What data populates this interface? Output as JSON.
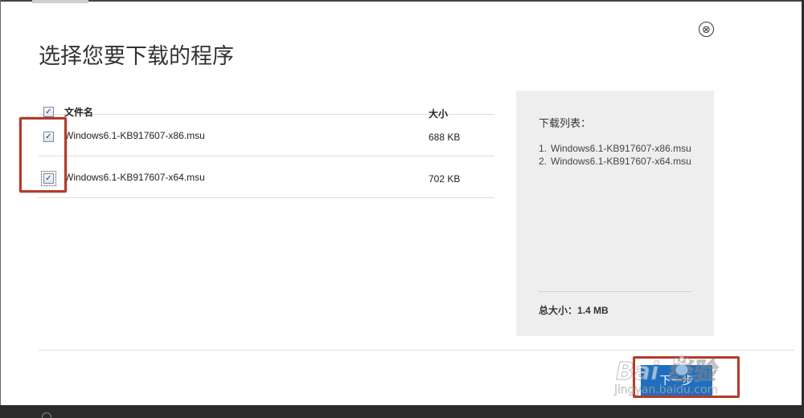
{
  "dialog": {
    "title": "选择您要下载的程序",
    "close_glyph": "⊗"
  },
  "table": {
    "header": {
      "name": "文件名",
      "size": "大小",
      "select_all_checked": true
    },
    "rows": [
      {
        "name": "Windows6.1-KB917607-x86.msu",
        "size": "688 KB",
        "checked": true
      },
      {
        "name": "Windows6.1-KB917607-x64.msu",
        "size": "702 KB",
        "checked": true
      }
    ],
    "check_glyph": "✓"
  },
  "download_panel": {
    "title": "下载列表：",
    "items": [
      {
        "num": "1.",
        "text": "Windows6.1-KB917607-x86.msu"
      },
      {
        "num": "2.",
        "text": "Windows6.1-KB917607-x64.msu"
      }
    ],
    "total_label": "总大小：",
    "total_value": "1.4 MB"
  },
  "footer": {
    "next_label": "下一步"
  },
  "watermark": {
    "main": "Bai  经验",
    "sub": "jingyan.baidu.com"
  },
  "colors": {
    "accent": "#1e6fc0",
    "highlight": "#b53a2a",
    "panel_bg": "#eeeeee"
  }
}
